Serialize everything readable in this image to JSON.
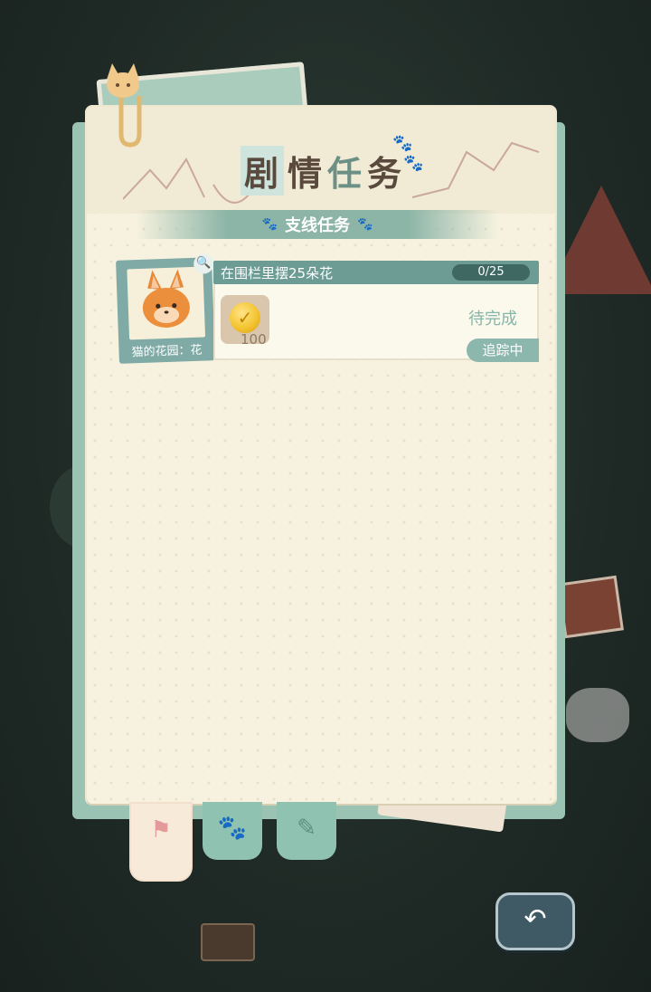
{
  "header": {
    "title_chars": [
      "剧",
      "情",
      "任",
      "务"
    ],
    "subtitle": "支线任务"
  },
  "quest": {
    "photo_label": "猫的花园：花",
    "title": "在围栏里摆25朵花",
    "progress_text": "0/25",
    "progress_current": 0,
    "progress_total": 25,
    "reward_icon": "gold-coin-icon",
    "reward_quantity": "100",
    "status": "待完成",
    "tracking_label": "追踪中"
  },
  "tabs": [
    {
      "icon": "story-flag-icon",
      "active": true
    },
    {
      "icon": "paw-card-icon",
      "active": false
    },
    {
      "icon": "notebook-icon",
      "active": false
    }
  ],
  "colors": {
    "accent_teal": "#6d9c95",
    "paper": "#f7f2e0",
    "status_text": "#86b5aa"
  }
}
